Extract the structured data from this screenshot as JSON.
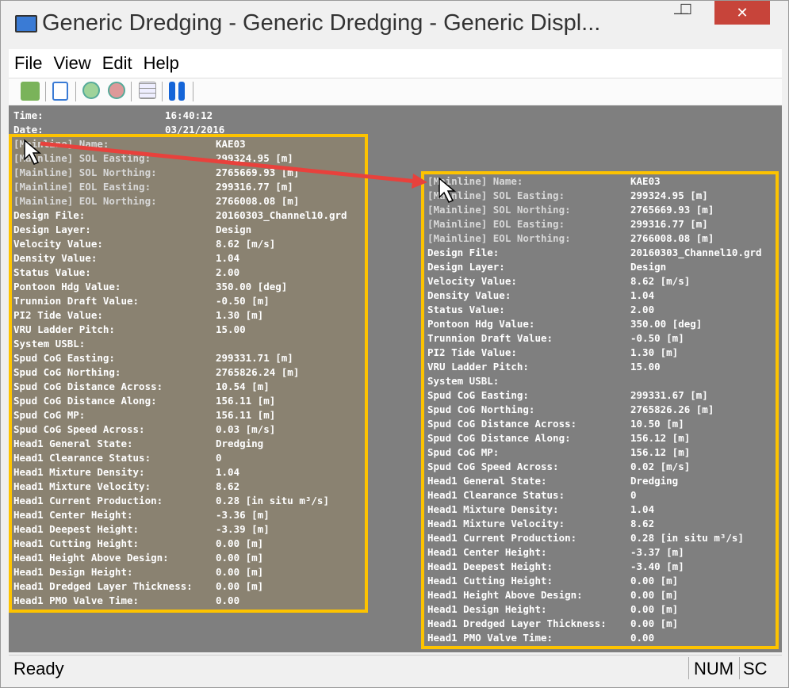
{
  "window": {
    "title": "Generic Dredging - Generic Dredging  - Generic Displ...",
    "minimize": "—",
    "maximize": "☐",
    "close": "✕"
  },
  "menu": [
    "File",
    "View",
    "Edit",
    "Help"
  ],
  "toolbar": [
    "user-icon",
    "checklist-icon",
    "zoom-in-icon",
    "zoom-out-icon",
    "grid-icon",
    "pause-icon"
  ],
  "header": {
    "time_label": "Time:",
    "time": "16:40:12",
    "date_label": "Date:",
    "date": "03/21/2016"
  },
  "labels": [
    "[Mainline] Name:",
    "[Mainline] SOL Easting:",
    "[Mainline] SOL Northing:",
    "[Mainline] EOL Easting:",
    "[Mainline] EOL Northing:",
    "Design File:",
    "Design Layer:",
    "Velocity Value:",
    "Density Value:",
    "Status Value:",
    "Pontoon Hdg Value:",
    "Trunnion Draft Value:",
    "PI2 Tide Value:",
    "VRU Ladder Pitch:",
    "System USBL:",
    "Spud CoG Easting:",
    "Spud CoG Northing:",
    "Spud CoG Distance Across:",
    "Spud CoG Distance Along:",
    "Spud CoG MP:",
    "Spud CoG Speed Across:",
    "Head1 General State:",
    "Head1 Clearance Status:",
    "Head1 Mixture Density:",
    "Head1 Mixture Velocity:",
    "Head1 Current Production:",
    "Head1 Center Height:",
    "Head1 Deepest Height:",
    "Head1 Cutting Height:",
    "Head1 Height Above Design:",
    "Head1 Design Height:",
    "Head1 Dredged Layer Thickness:",
    "Head1 PMO Valve Time:"
  ],
  "left_values": [
    "KAE03",
    "299324.95 [m]",
    "2765669.93 [m]",
    "299316.77 [m]",
    "2766008.08 [m]",
    "20160303_Channel10.grd",
    "Design",
    "8.62 [m/s]",
    "1.04",
    "2.00",
    "350.00 [deg]",
    "-0.50 [m]",
    "1.30 [m]",
    "15.00",
    "",
    "299331.71 [m]",
    "2765826.24 [m]",
    "10.54 [m]",
    "156.11 [m]",
    "156.11 [m]",
    "0.03 [m/s]",
    "Dredging",
    "0",
    "1.04",
    "8.62",
    "0.28 [in situ m³/s]",
    "-3.36 [m]",
    "-3.39 [m]",
    "0.00 [m]",
    "0.00 [m]",
    "0.00 [m]",
    "0.00 [m]",
    "0.00"
  ],
  "right_values": [
    "KAE03",
    "299324.95 [m]",
    "2765669.93 [m]",
    "299316.77 [m]",
    "2766008.08 [m]",
    "20160303_Channel10.grd",
    "Design",
    "8.62 [m/s]",
    "1.04",
    "2.00",
    "350.00 [deg]",
    "-0.50 [m]",
    "1.30 [m]",
    "15.00",
    "",
    "299331.67 [m]",
    "2765826.26 [m]",
    "10.50 [m]",
    "156.12 [m]",
    "156.12 [m]",
    "0.02 [m/s]",
    "Dredging",
    "0",
    "1.04",
    "8.62",
    "0.28 [in situ m³/s]",
    "-3.37 [m]",
    "-3.40 [m]",
    "0.00 [m]",
    "0.00 [m]",
    "0.00 [m]",
    "0.00 [m]",
    "0.00"
  ],
  "statusbar": {
    "text": "Ready",
    "num": "NUM",
    "scrl": "SC"
  },
  "colors": {
    "highlight": "#fdc300",
    "left_fill": "#8a8271",
    "arrow": "#e8413c"
  }
}
